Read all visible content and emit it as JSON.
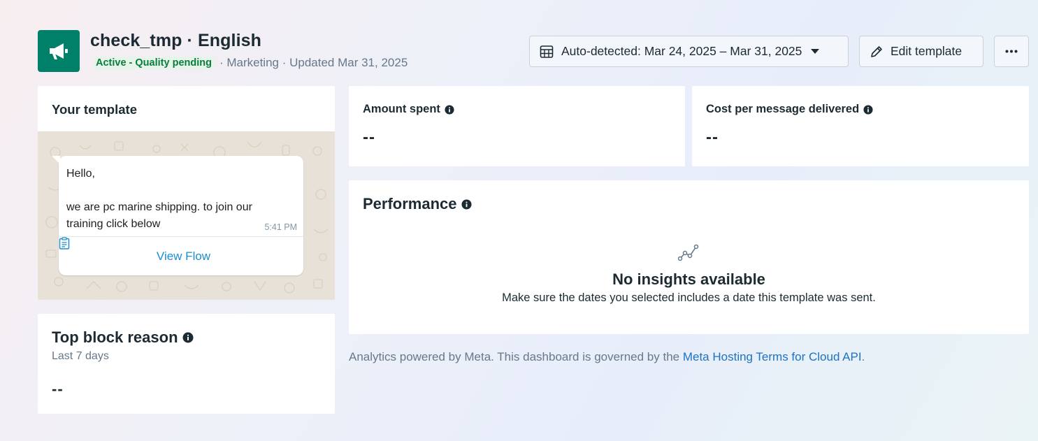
{
  "header": {
    "title": "check_tmp · English",
    "status": "Active - Quality pending",
    "meta": "· Marketing · Updated Mar 31, 2025",
    "icon": "megaphone-icon"
  },
  "toolbar": {
    "date_range_label": "Auto-detected: Mar 24, 2025 – Mar 31, 2025",
    "edit_label": "Edit template",
    "more_icon": "more-icon"
  },
  "template_card": {
    "title": "Your template",
    "message": "Hello,\n\nwe are pc marine shipping. to join our training click below",
    "time": "5:41 PM",
    "button_label": "View Flow"
  },
  "top_block": {
    "title": "Top block reason",
    "period": "Last 7 days",
    "value": "--"
  },
  "metrics": {
    "amount_spent": {
      "title": "Amount spent",
      "value": "--"
    },
    "cost_per_message": {
      "title": "Cost per message delivered",
      "value": "--"
    }
  },
  "performance": {
    "title": "Performance",
    "empty_title": "No insights available",
    "empty_text": "Make sure the dates you selected includes a date this template was sent."
  },
  "footer": {
    "text": "Analytics powered by Meta. This dashboard is governed by the ",
    "link": "Meta Hosting Terms for Cloud API",
    "suffix": "."
  },
  "colors": {
    "brand_green": "#008069",
    "status_green": "#0a7d3c",
    "link_blue": "#1d72c1",
    "flow_blue": "#1d8ecf"
  }
}
